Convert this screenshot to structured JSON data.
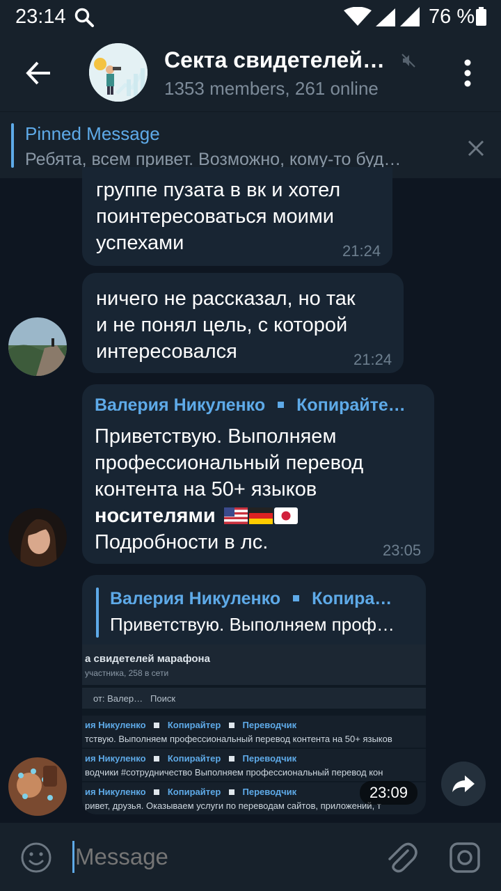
{
  "status_bar": {
    "time": "23:14",
    "battery": "76 %"
  },
  "header": {
    "title": "Секта свидетелей…",
    "subtitle": "1353 members, 261 online"
  },
  "pinned": {
    "title": "Pinned Message",
    "text": "Ребята, всем привет. Возможно, кому-то буд…"
  },
  "messages": [
    {
      "lines": [
        "группе пузата в вк  и хотел",
        "поинтересоваться моими",
        "успехами"
      ],
      "time": "21:24"
    },
    {
      "lines": [
        "ничего не рассказал, но так",
        "и не понял цель, с которой",
        "интересовался"
      ],
      "time": "21:24"
    },
    {
      "sender": "Валерия Никуленко",
      "sender_role": "Копирайте…",
      "lines": [
        "Приветствую. Выполняем",
        "профессиональный перевод",
        "контента на 50+ языков"
      ],
      "bold_line": "носителями",
      "last_line": "Подробности в лс.",
      "time": "23:05"
    },
    {
      "reply_sender": "Валерия Никуленко",
      "reply_role": "Копира…",
      "reply_text": "Приветствую. Выполняем проф…",
      "time": "23:09"
    }
  ],
  "embedded_screenshot": {
    "title": "а свидетелей марафона",
    "subtitle": "участника, 258 в сети",
    "filter_from": "от: Валер…",
    "filter_search": "Поиск",
    "rows": [
      {
        "name": "ия Никуленко",
        "role1": "Копирайтер",
        "role2": "Переводчик",
        "text": "тствую. Выполняем профессиональный перевод контента на 50+ языков"
      },
      {
        "name": "ия Никуленко",
        "role1": "Копирайтер",
        "role2": "Переводчик",
        "text": "водчики #сотрудничество   Выполняем профессиональный перевод кон"
      },
      {
        "name": "ия Никуленко",
        "role1": "Копирайтер",
        "role2": "Переводчик",
        "text": "ривет, друзья. Оказываем услуги по переводам сайтов, приложений, т"
      }
    ]
  },
  "composer": {
    "placeholder": "Message"
  },
  "colors": {
    "background": "#0e1621",
    "bar": "#17212b",
    "bubble": "#182533",
    "accent": "#5eaae8"
  }
}
